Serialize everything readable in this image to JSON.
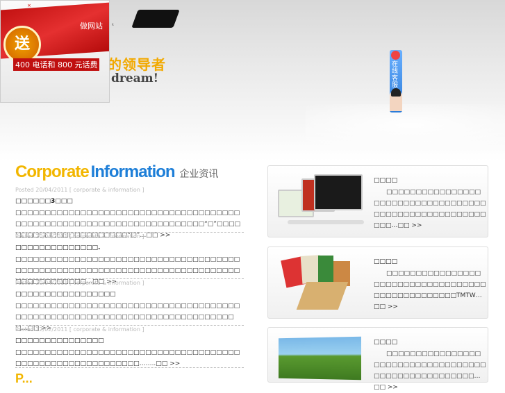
{
  "header": {
    "slogan_cn": "的领导者",
    "slogan_en": "dream!",
    "nav_mark": "k"
  },
  "promo": {
    "close": "×",
    "seal": "送",
    "line1": "做网站",
    "line2": "400 电话和 800 元话费"
  },
  "service": {
    "label": "在线客服"
  },
  "corporate": {
    "title_part1": "Corporate",
    "title_part2": "Information",
    "title_cn": "企业资讯",
    "posts": [
      {
        "meta": "Posted 20/04/2011 [ corporate & information ]",
        "title": "□□□□□□3□□□",
        "body": "□□□□□□□□□□□□□□□□□□□□□□□□□□□□□□□□□□□□□□□□□□□□□□□□□□□□□□□□□□□□□□□□□□□□□□“□”□□□□□□□□□□□□□□□□□□□□□□□“□”…□□",
        "more": ">>"
      },
      {
        "meta": "Posted 20/04/2011 [ corporate & information ]",
        "title": "□□□□□□□□□□□□□□.",
        "body": "□□□□□□□□□□□□□□□□□□□□□□□□□□□□□□□□□□□□□□□□□□□□□□□□□□□□□□□□□□□□□□□□□□□□□□□□□□□□□□□□□□□□□□□□…□□",
        "more": ">>"
      },
      {
        "meta": "Posted 20/04/2011 [ corporate & information ]",
        "title": "□□□□□□□□□□□□□□□□□",
        "body": "□□□□□□□□□□□□□□□□□□□□□□□□□□□□□□□□□□□□□□□□□□□□□□□□□□□□□□□□□□□□□□□□□□□□□□□□□□□□…□□",
        "more": ">>"
      },
      {
        "meta": "Posted 12/02/2011 [ corporate & information ]",
        "title": "□□□□□□□□□□□□□□□",
        "body": "□□□□□□□□□□□□□□□□□□□□□□□□□□□□□□□□□□□□□□□□□□□□□□□□□□□□□□□□□□□……..□□",
        "more": ">>"
      }
    ],
    "next_section_partial": "P..."
  },
  "services": [
    {
      "title": "□□□□",
      "body": "□□□□□□□□□□□□□□□□□□□□□□□□□□□□□□□□□□□□□□□□□□□□□□□□□□□□□□□□□…□□",
      "more": ">>"
    },
    {
      "title": "□□□□",
      "body": "□□□□□□□□□□□□□□□□□□□□□□□□□□□□□□□□□□□□□□□□□□□□□□□□□TMTW…□□",
      "more": ">>"
    },
    {
      "title": "□□□□",
      "body": "□□□□□□□□□□□□□□□□□□□□□□□□□□□□□□□□□□□□□□□□□□□□□□□□□□□□…□□",
      "more": ">>"
    }
  ]
}
